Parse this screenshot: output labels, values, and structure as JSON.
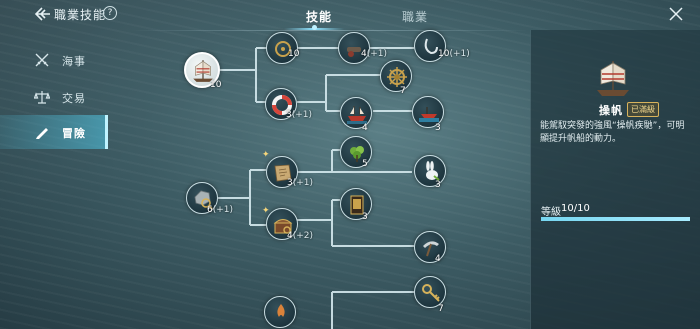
{
  "header": {
    "title": "職業技能",
    "help_label": "?",
    "tabs": [
      {
        "label": "技能",
        "active": true
      },
      {
        "label": "職業",
        "active": false
      }
    ]
  },
  "sidebar": {
    "items": [
      {
        "label": "海事",
        "icon": "crossed-swords-icon",
        "active": false
      },
      {
        "label": "交易",
        "icon": "scales-icon",
        "active": false
      },
      {
        "label": "冒險",
        "icon": "pen-icon",
        "active": true
      }
    ]
  },
  "tree": {
    "nodes": [
      {
        "id": "sail",
        "icon": "ship-sail-icon",
        "level": "10",
        "bonus": ""
      },
      {
        "id": "helm-top",
        "icon": "helm-icon",
        "level": "10",
        "bonus": ""
      },
      {
        "id": "cannon-top",
        "icon": "cannon-icon",
        "level": "4",
        "bonus": "(+1)"
      },
      {
        "id": "hook-top",
        "icon": "hook-icon",
        "level": "10",
        "bonus": "(+1)"
      },
      {
        "id": "lifebuoy",
        "icon": "lifebuoy-icon",
        "level": "3",
        "bonus": "(+1)"
      },
      {
        "id": "wheel",
        "icon": "ship-wheel-icon",
        "level": "7",
        "bonus": ""
      },
      {
        "id": "ship-red",
        "icon": "red-ship-icon",
        "level": "4",
        "bonus": ""
      },
      {
        "id": "boat",
        "icon": "boat-icon",
        "level": "3",
        "bonus": ""
      },
      {
        "id": "map",
        "icon": "map-scroll-icon",
        "level": "3",
        "bonus": "(+1)"
      },
      {
        "id": "herb",
        "icon": "herb-icon",
        "level": "5",
        "bonus": ""
      },
      {
        "id": "rabbit",
        "icon": "rabbit-icon",
        "level": "3",
        "bonus": ""
      },
      {
        "id": "ore",
        "icon": "ore-magnifier-icon",
        "level": "6",
        "bonus": "(+1)"
      },
      {
        "id": "chest",
        "icon": "treasure-chest-icon",
        "level": "4",
        "bonus": "(+2)"
      },
      {
        "id": "card",
        "icon": "treasure-card-icon",
        "level": "3",
        "bonus": ""
      },
      {
        "id": "pickaxe",
        "icon": "pickaxe-icon",
        "level": "4",
        "bonus": ""
      },
      {
        "id": "bottom-left",
        "icon": "fire-icon",
        "level": "",
        "bonus": ""
      },
      {
        "id": "key",
        "icon": "key-icon",
        "level": "7",
        "bonus": ""
      }
    ],
    "upgrade_marker": "✦"
  },
  "detail": {
    "skill_name": "操帆",
    "badge": "已滿級",
    "description": "能駕馭突發的強風“操帆疾馳”，可明顯提升帆船的動力。",
    "level_label": "等級",
    "level_value": "10/10",
    "level_progress": 1.0,
    "icon": "ship-sail-icon"
  },
  "colors": {
    "accent": "#8fe3ff",
    "badge_gold": "#f3d88d",
    "connector": "#d5e9ee"
  }
}
